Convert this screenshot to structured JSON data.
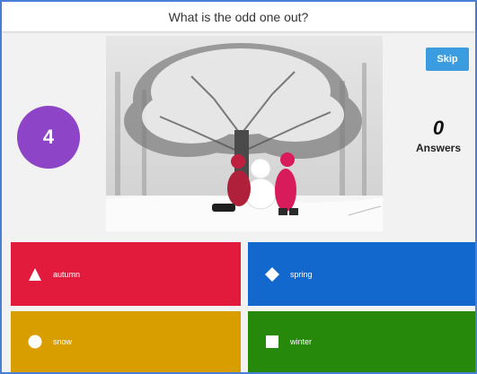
{
  "question": {
    "text": "What is the odd one out?"
  },
  "timer": {
    "value": "4"
  },
  "skip": {
    "label": "Skip"
  },
  "answers_count": {
    "value": "0",
    "label": "Answers"
  },
  "answer_options": [
    {
      "label": "autumn",
      "shape": "triangle-icon",
      "color": "#e21b3c"
    },
    {
      "label": "spring",
      "shape": "diamond-icon",
      "color": "#1368ce"
    },
    {
      "label": "snow",
      "shape": "circle-icon",
      "color": "#d89e00"
    },
    {
      "label": "winter",
      "shape": "square-icon",
      "color": "#26890c"
    }
  ],
  "colors": {
    "timer": "#8e44c6",
    "skip": "#3b9ce0",
    "frame_border": "#4a7fd6"
  }
}
